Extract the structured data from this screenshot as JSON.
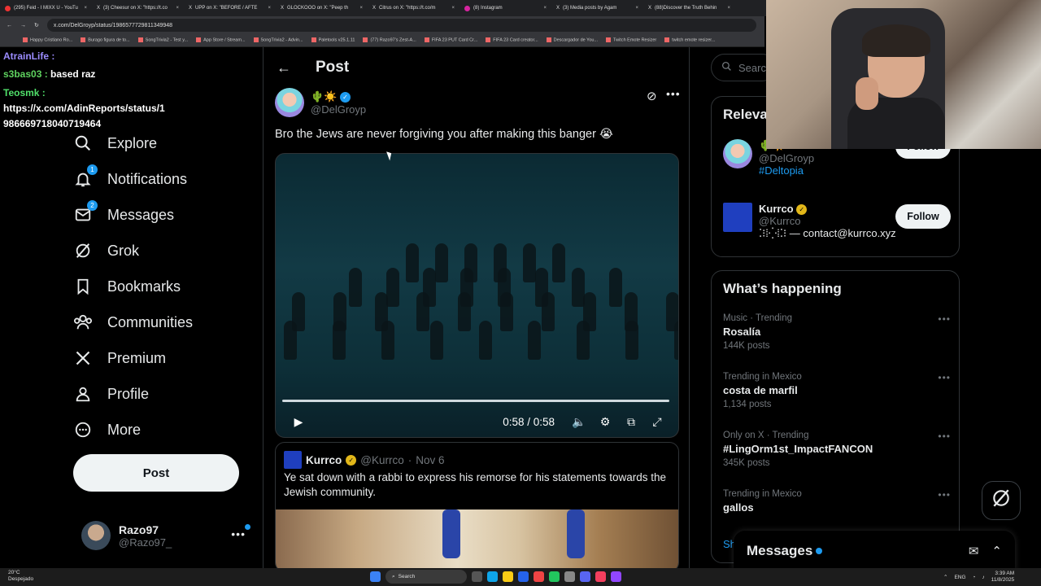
{
  "browser": {
    "tabs": [
      "(295) Feid - I MIXX U - YouTu",
      "(3) Cheesur on X: \"https://t.co",
      "UPP on X: \"BEFORE / AFTE",
      "GLOCKOOO on X: \"Peep th",
      "Citrus on X: \"https://t.co/m",
      "(8) Instagram",
      "(3) Media posts by Agam",
      "(88)Discover the Truth Behin"
    ],
    "url": "x.com/DelGroyp/status/1986577729811349948",
    "bookmarks": [
      "Happy Cristiano Ro...",
      "Burago figura de to...",
      "SongTrivia2 - Test y...",
      "App Store / Stream...",
      "SongTrivia2 - Advin...",
      "Paletools v25.1.11",
      "(77) Razo97's Zest-A...",
      "FIFA 23 PUT Card Cr...",
      "FIFA 23 Card creator...",
      "Descargador de You...",
      "Twitch Emote Resizer",
      "twitch emote resizer..."
    ]
  },
  "chat": {
    "lines": [
      {
        "user": "AtrainLife :",
        "msg": ""
      },
      {
        "user": "s3bas03 :",
        "msg": "based raz"
      },
      {
        "user": "Teosmk :",
        "msg": ""
      },
      {
        "user": "",
        "msg": "https://x.com/AdinReports/status/1"
      },
      {
        "user": "",
        "msg": "986669718040719464"
      }
    ]
  },
  "nav": {
    "items": [
      {
        "label": "Explore",
        "icon": "search-icon"
      },
      {
        "label": "Notifications",
        "icon": "bell-icon",
        "badge": "1"
      },
      {
        "label": "Messages",
        "icon": "mail-icon",
        "badge": "2"
      },
      {
        "label": "Grok",
        "icon": "grok-icon"
      },
      {
        "label": "Bookmarks",
        "icon": "bookmark-icon"
      },
      {
        "label": "Communities",
        "icon": "communities-icon"
      },
      {
        "label": "Premium",
        "icon": "x-logo-icon"
      },
      {
        "label": "Profile",
        "icon": "person-icon"
      },
      {
        "label": "More",
        "icon": "more-circle-icon"
      }
    ],
    "post_label": "Post"
  },
  "account": {
    "name": "Razo97",
    "handle": "@Razo97_"
  },
  "main": {
    "header_title": "Post",
    "author_emoji": "🌵☀️",
    "author_handle": "@DelGroyp",
    "tweet_text": "Bro the Jews are never forgiving you after making this banger 😭",
    "video": {
      "time": "0:58 / 0:58",
      "progress": 1.0
    },
    "quote": {
      "name": "Kurrco",
      "handle": "@Kurrco",
      "sep": "·",
      "date": "Nov 6",
      "text": "Ye sat down with a rabbi to express his remorse for his statements towards the Jewish community."
    }
  },
  "sidebar": {
    "search_placeholder": "Search",
    "relevant_title": "Relevant people",
    "relevant": [
      {
        "name": "🌵☀️",
        "handle": "@DelGroyp",
        "bio": "#Deltopia",
        "follow": "Follow"
      },
      {
        "name": "Kurrco",
        "handle": "@Kurrco",
        "bio": "⁚⁝⁞⁛⁞⁚⁝ — contact@kurrco.xyz",
        "follow": "Follow"
      }
    ],
    "happening_title": "What’s happening",
    "trends": [
      {
        "context": "Music · Trending",
        "name": "Rosalía",
        "count": "144K posts"
      },
      {
        "context": "Trending in Mexico",
        "name": "costa de marfil",
        "count": "1,134 posts"
      },
      {
        "context": "Only on X · Trending",
        "name": "#LingOrm1st_ImpactFANCON",
        "count": "345K posts"
      },
      {
        "context": "Trending in Mexico",
        "name": "gallos",
        "count": ""
      }
    ],
    "show_more": "Show more"
  },
  "messages_drawer": {
    "title": "Messages"
  },
  "taskbar": {
    "weather_temp": "20°C",
    "weather_desc": "Despejado",
    "search": "Search",
    "lang": "ENG",
    "time": "3:39 AM",
    "date": "11/8/2025"
  },
  "colors": {
    "accent": "#1d9bf0",
    "background": "#000000",
    "border": "#2f3336",
    "muted": "#71767b"
  }
}
